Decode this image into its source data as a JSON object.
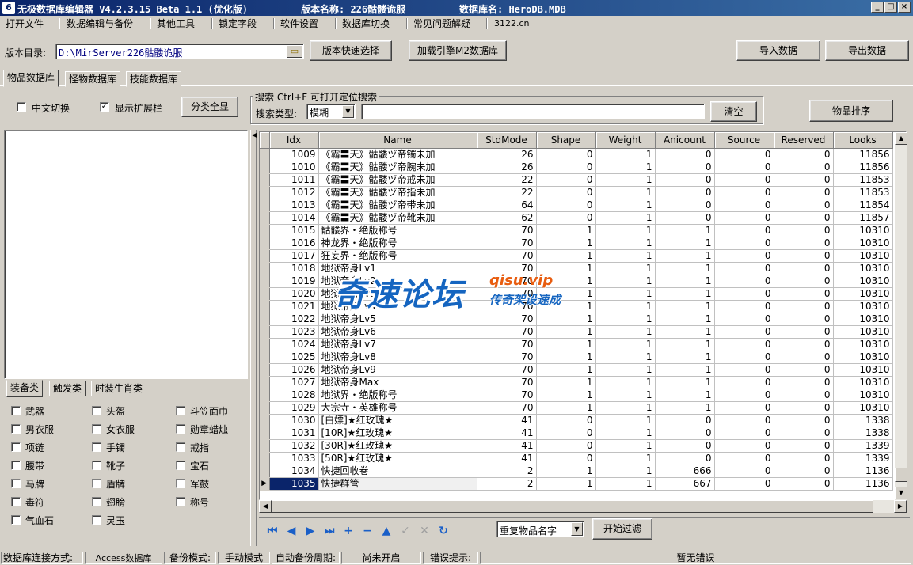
{
  "window": {
    "app_title": "无极数据库编辑器 V4.2.3.15  Beta 1.1 (优化版)",
    "version_name": "版本名称: 226骷髅诡服",
    "db_name": "数据库名: HeroDB.MDB"
  },
  "menu": [
    "打开文件",
    "数据编辑与备份",
    "其他工具",
    "锁定字段",
    "软件设置",
    "数据库切换",
    "常见问题解疑",
    "3122.cn"
  ],
  "toolbar": {
    "dir_label": "版本目录:",
    "dir_value": "D:\\MirServer226骷髅诡服",
    "quick_select": "版本快速选择",
    "load_m2": "加载引擎M2数据库",
    "import": "导入数据",
    "export": "导出数据"
  },
  "main_tabs": [
    "物品数据库",
    "怪物数据库",
    "技能数据库"
  ],
  "options": {
    "chinese_toggle": "中文切换",
    "chinese_checked": false,
    "show_ext": "显示扩展栏",
    "show_ext_checked": true,
    "show_all": "分类全显"
  },
  "search": {
    "group_title": "搜索  Ctrl+F 可打开定位搜索",
    "type_label": "搜索类型:",
    "type_value": "模糊",
    "query": "",
    "clear": "清空"
  },
  "sort_button": "物品排序",
  "category_tabs": [
    "装备类",
    "触发类",
    "时装生肖类"
  ],
  "categories": [
    "武器",
    "头盔",
    "斗笠面巾",
    "男衣服",
    "女衣服",
    "勋章蜡烛",
    "项链",
    "手镯",
    "戒指",
    "腰带",
    "靴子",
    "宝石",
    "马牌",
    "盾牌",
    "军鼓",
    "毒符",
    "翅膀",
    "称号",
    "气血石",
    "灵玉"
  ],
  "table": {
    "columns": [
      "Idx",
      "Name",
      "StdMode",
      "Shape",
      "Weight",
      "Anicount",
      "Source",
      "Reserved",
      "Looks"
    ],
    "rows": [
      [
        "1009",
        "《霸〓天》骷髅ヅ帝镯未加",
        "26",
        "0",
        "1",
        "0",
        "0",
        "0",
        "11856"
      ],
      [
        "1010",
        "《霸〓天》骷髅ヅ帝腕未加",
        "26",
        "0",
        "1",
        "0",
        "0",
        "0",
        "11856"
      ],
      [
        "1011",
        "《霸〓天》骷髅ヅ帝戒未加",
        "22",
        "0",
        "1",
        "0",
        "0",
        "0",
        "11853"
      ],
      [
        "1012",
        "《霸〓天》骷髅ヅ帝指未加",
        "22",
        "0",
        "1",
        "0",
        "0",
        "0",
        "11853"
      ],
      [
        "1013",
        "《霸〓天》骷髅ヅ帝带未加",
        "64",
        "0",
        "1",
        "0",
        "0",
        "0",
        "11854"
      ],
      [
        "1014",
        "《霸〓天》骷髅ヅ帝靴未加",
        "62",
        "0",
        "1",
        "0",
        "0",
        "0",
        "11857"
      ],
      [
        "1015",
        "骷髅界・绝版称号",
        "70",
        "1",
        "1",
        "1",
        "0",
        "0",
        "10310"
      ],
      [
        "1016",
        "神龙界・绝版称号",
        "70",
        "1",
        "1",
        "1",
        "0",
        "0",
        "10310"
      ],
      [
        "1017",
        "狂妄界・绝版称号",
        "70",
        "1",
        "1",
        "1",
        "0",
        "0",
        "10310"
      ],
      [
        "1018",
        "地狱帝身Lv1",
        "70",
        "1",
        "1",
        "1",
        "0",
        "0",
        "10310"
      ],
      [
        "1019",
        "地狱帝身Lv2",
        "70",
        "1",
        "1",
        "1",
        "0",
        "0",
        "10310"
      ],
      [
        "1020",
        "地狱帝身Lv3",
        "70",
        "1",
        "1",
        "1",
        "0",
        "0",
        "10310"
      ],
      [
        "1021",
        "地狱帝身Lv4",
        "70",
        "1",
        "1",
        "1",
        "0",
        "0",
        "10310"
      ],
      [
        "1022",
        "地狱帝身Lv5",
        "70",
        "1",
        "1",
        "1",
        "0",
        "0",
        "10310"
      ],
      [
        "1023",
        "地狱帝身Lv6",
        "70",
        "1",
        "1",
        "1",
        "0",
        "0",
        "10310"
      ],
      [
        "1024",
        "地狱帝身Lv7",
        "70",
        "1",
        "1",
        "1",
        "0",
        "0",
        "10310"
      ],
      [
        "1025",
        "地狱帝身Lv8",
        "70",
        "1",
        "1",
        "1",
        "0",
        "0",
        "10310"
      ],
      [
        "1026",
        "地狱帝身Lv9",
        "70",
        "1",
        "1",
        "1",
        "0",
        "0",
        "10310"
      ],
      [
        "1027",
        "地狱帝身Max",
        "70",
        "1",
        "1",
        "1",
        "0",
        "0",
        "10310"
      ],
      [
        "1028",
        "地狱界・绝版称号",
        "70",
        "1",
        "1",
        "1",
        "0",
        "0",
        "10310"
      ],
      [
        "1029",
        "大宗寺・英雄称号",
        "70",
        "1",
        "1",
        "1",
        "0",
        "0",
        "10310"
      ],
      [
        "1030",
        "[白嫖]★红玫瑰★",
        "41",
        "0",
        "1",
        "0",
        "0",
        "0",
        "1338"
      ],
      [
        "1031",
        "[10R]★红玫瑰★",
        "41",
        "0",
        "1",
        "0",
        "0",
        "0",
        "1338"
      ],
      [
        "1032",
        "[30R]★红玫瑰★",
        "41",
        "0",
        "1",
        "0",
        "0",
        "0",
        "1339"
      ],
      [
        "1033",
        "[50R]★红玫瑰★",
        "41",
        "0",
        "1",
        "0",
        "0",
        "0",
        "1339"
      ],
      [
        "1034",
        "快捷回收卷",
        "2",
        "1",
        "1",
        "666",
        "0",
        "0",
        "1136"
      ],
      [
        "1035",
        "快捷群管",
        "2",
        "1",
        "1",
        "667",
        "0",
        "0",
        "1136"
      ]
    ],
    "selected_idx": "1035"
  },
  "filter": {
    "mode": "重复物品名字",
    "start": "开始过滤"
  },
  "status": {
    "conn_label": "数据库连接方式:",
    "conn_value": "Access数据库",
    "backup_label": "备份模式:",
    "backup_value": "手动模式",
    "auto_label": "自动备份周期:",
    "auto_value": "尚未开启",
    "err_label": "错误提示:",
    "err_value": "暂无错误"
  },
  "watermark": {
    "main": "奇速论坛",
    "url": "qisu.vip",
    "sub": "传奇架设速成"
  }
}
